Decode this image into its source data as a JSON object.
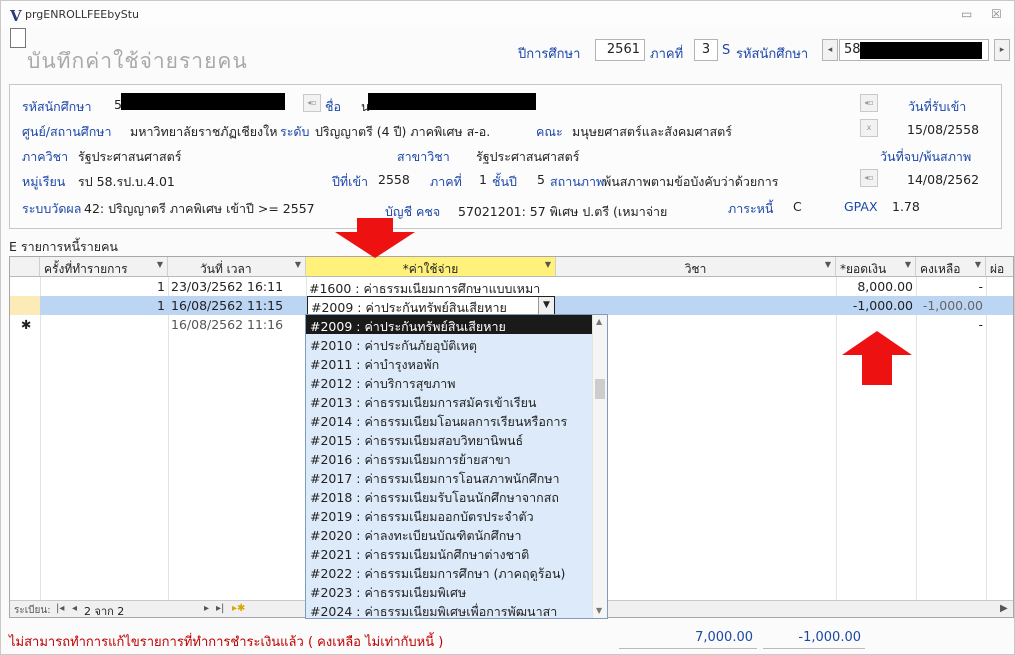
{
  "window": {
    "title": "prgENROLLFEEbyStu",
    "icon_letter": "V",
    "minimize": "▭",
    "close": "☒"
  },
  "form": {
    "caption": "บันทึกค่าใช้จ่ายรายคน"
  },
  "header": {
    "year_label": "ปีการศึกษา",
    "year": "2561",
    "term_label": "ภาคที่",
    "term": "3",
    "student_id_label": "รหัสนักศึกษา",
    "student_id": "58",
    "s_icon": "S",
    "prev": "◂",
    "next": "▸"
  },
  "info": {
    "student_id_label": "รหัสนักศึกษา",
    "student_id_prefix": "5",
    "name_label": "ชื่อ",
    "name_prefix": "น",
    "entry_date_label": "วันที่รับเข้า",
    "entry_date": "15/08/2558",
    "center_label": "ศูนย์/สถานศึกษา",
    "center": "มหาวิทยาลัยราชภัฏเชียงใหม่",
    "level_label": "ระดับ",
    "level": "ปริญญาตรี (4 ปี) ภาคพิเศษ ส-อ.",
    "faculty_label": "คณะ",
    "faculty": "มนุษยศาสตร์และสังคมศาสตร์",
    "dept_label": "ภาควิชา",
    "dept": "รัฐประศาสนศาสตร์",
    "major_label": "สาขาวิชา",
    "major": "รัฐประศาสนศาสตร์",
    "grad_label": "วันที่จบ/พ้นสภาพ",
    "group_label": "หมู่เรียน",
    "group": "รป 58.รป.บ.4.01",
    "entry_year_label": "ปีที่เข้า",
    "entry_year": "2558",
    "term_label": "ภาคที่",
    "term": "1",
    "class_year_label": "ชั้นปี",
    "class_year": "5",
    "status_label": "สถานภาพ",
    "status": "พ้นสภาพตามข้อบังคับว่าด้วยการ",
    "status_date": "14/08/2562",
    "grading_label": "ระบบวัดผล",
    "grading": "42: ปริญญาตรี ภาคพิเศษ เข้าปี >= 2557",
    "account_label": "บัญชี คชจ",
    "account": "57021201: 57 พิเศษ ป.ตรี (เหมาจ่าย",
    "debt_label": "ภาระหนี้",
    "debt": "C",
    "gpax_label": "GPAX",
    "gpax": "1.78",
    "mini_btn": "◂▫",
    "x_btn": "x"
  },
  "section": {
    "title": "E รายการหนี้รายคน"
  },
  "grid": {
    "columns": [
      "ครั้งที่ทำรายการ",
      "วันที่ เวลา",
      "*ค่าใช้จ่าย",
      "วิชา",
      "*ยอดเงิน",
      "คงเหลือ",
      "ผ่อ"
    ],
    "rows": [
      {
        "seq": "1",
        "datetime": "23/03/2562 16:11",
        "expense": "#1600 : ค่าธรรมเนียมการศึกษาแบบเหมา",
        "subject": "",
        "amount": "8,000.00",
        "balance": "-"
      },
      {
        "seq": "1",
        "datetime": "16/08/2562 11:15",
        "expense": "#2009 : ค่าประกันทรัพย์สินเสียหาย",
        "subject": "",
        "amount": "-1,000.00",
        "balance": "-1,000.00"
      },
      {
        "seq": "",
        "datetime": "16/08/2562 11:16",
        "expense": "",
        "subject": "",
        "amount": "",
        "balance": "-"
      }
    ],
    "new_row_marker": "✱"
  },
  "dropdown": {
    "items": [
      "#2009 : ค่าประกันทรัพย์สินเสียหาย",
      "#2010 : ค่าประกันภัยอุบัติเหตุ",
      "#2011 : ค่าบำรุงหอพัก",
      "#2012 : ค่าบริการสุขภาพ",
      "#2013 : ค่าธรรมเนียมการสมัครเข้าเรียน",
      "#2014 : ค่าธรรมเนียมโอนผลการเรียนหรือการ",
      "#2015 : ค่าธรรมเนียมสอบวิทยานิพนธ์",
      "#2016 : ค่าธรรมเนียมการย้ายสาขา",
      "#2017 : ค่าธรรมเนียมการโอนสภาพนักศึกษา",
      "#2018 : ค่าธรรมเนียมรับโอนนักศึกษาจากสถ",
      "#2019 : ค่าธรรมเนียมออกบัตรประจำตัว",
      "#2020 : ค่าลงทะเบียนบัณฑิตนักศึกษา",
      "#2021 : ค่าธรรมเนียมนักศึกษาต่างชาติ",
      "#2022 : ค่าธรรมเนียมการศึกษา (ภาคฤดูร้อน)",
      "#2023 : ค่าธรรมเนียมพิเศษ",
      "#2024 : ค่าธรรมเนียมพิเศษเพื่อการพัฒนาสา"
    ]
  },
  "record_nav": {
    "label": "ระเบียน:",
    "first": "|◂",
    "prev": "◂",
    "current": "2 จาก 2",
    "next": "▸",
    "last": "▸|",
    "new": "▸✱"
  },
  "status": {
    "message": "ไม่สามารถทำการแก้ไขรายการที่ทำการชำระเงินแล้ว ( คงเหลือ ไม่เท่ากับหนี้ )",
    "total_amount": "7,000.00",
    "total_balance": "-1,000.00"
  }
}
